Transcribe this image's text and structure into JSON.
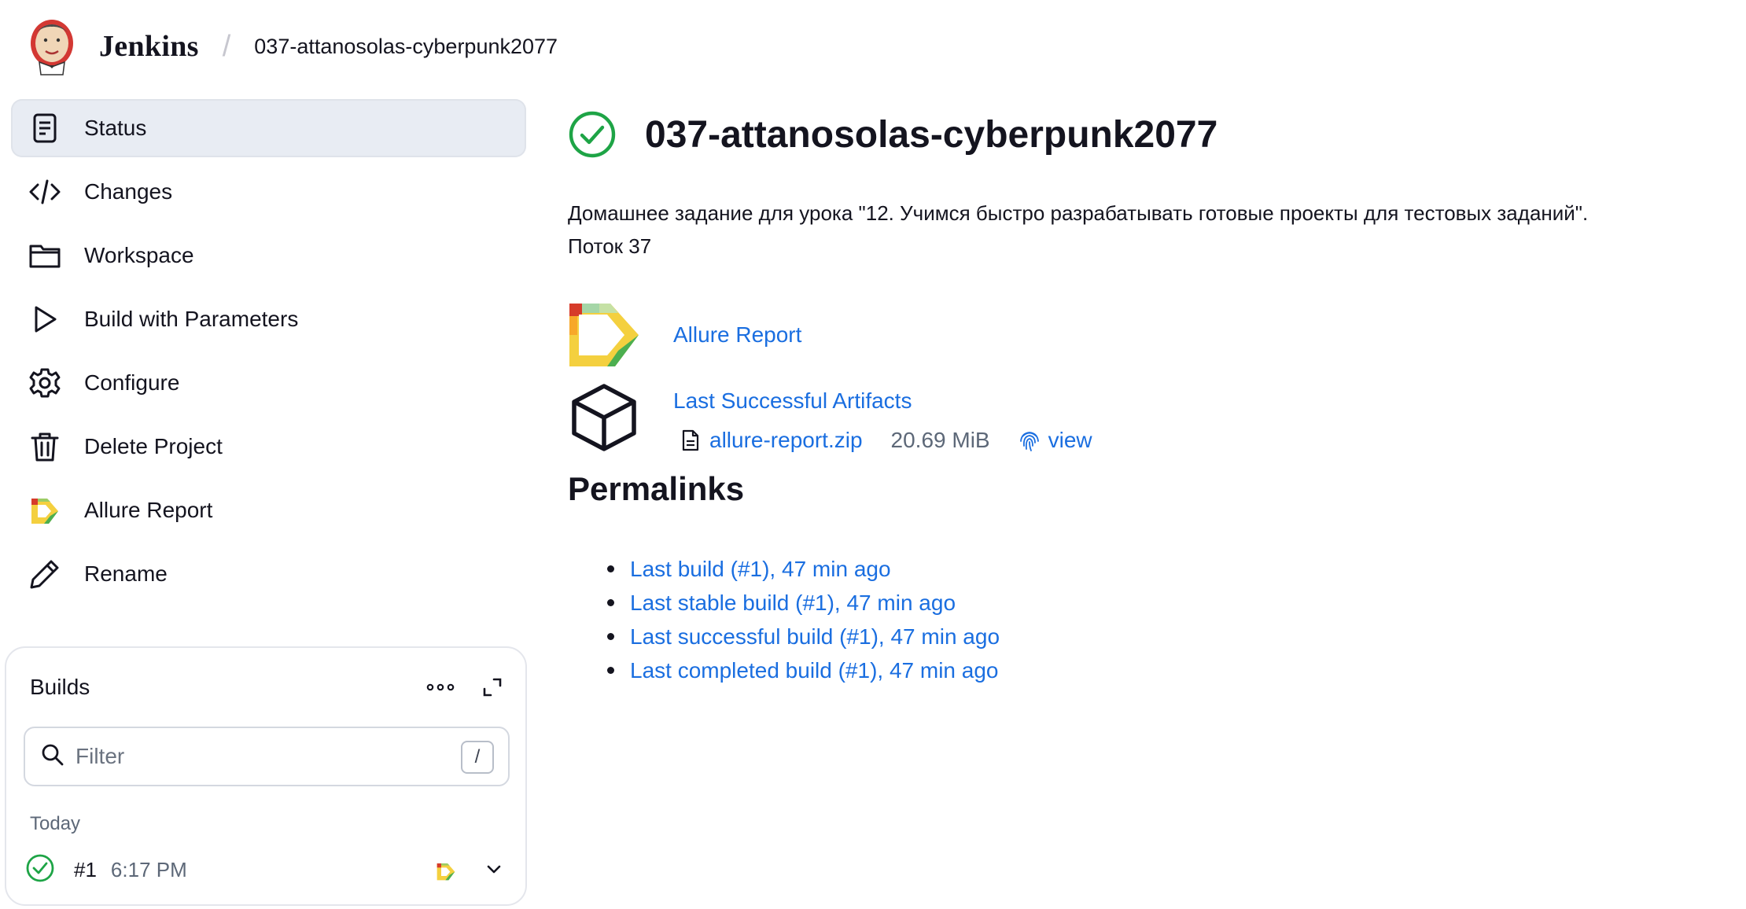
{
  "header": {
    "brand": "Jenkins",
    "separator": "/",
    "breadcrumb": "037-attanosolas-cyberpunk2077"
  },
  "sidebar": {
    "items": [
      {
        "label": "Status",
        "icon": "status-document-icon",
        "active": true
      },
      {
        "label": "Changes",
        "icon": "code-icon"
      },
      {
        "label": "Workspace",
        "icon": "folder-icon"
      },
      {
        "label": "Build with Parameters",
        "icon": "play-icon"
      },
      {
        "label": "Configure",
        "icon": "gear-icon"
      },
      {
        "label": "Delete Project",
        "icon": "trash-icon"
      },
      {
        "label": "Allure Report",
        "icon": "allure-icon"
      },
      {
        "label": "Rename",
        "icon": "pencil-icon"
      }
    ]
  },
  "builds": {
    "title": "Builds",
    "filter_placeholder": "Filter",
    "shortcut_key": "/",
    "group_label": "Today",
    "rows": [
      {
        "number": "#1",
        "time": "6:17 PM",
        "status": "success"
      }
    ]
  },
  "main": {
    "title": "037-attanosolas-cyberpunk2077",
    "description_line1": "Домашнее задание для урока \"12. Учимся быстро разрабатывать готовые проекты для тестовых заданий\".",
    "description_line2": "Поток 37",
    "allure_link": "Allure Report",
    "artifacts_link": "Last Successful Artifacts",
    "artifact_file": "allure-report.zip",
    "artifact_size": "20.69 MiB",
    "artifact_view": "view",
    "permalinks_heading": "Permalinks",
    "permalinks": [
      "Last build (#1), 47 min ago",
      "Last stable build (#1), 47 min ago",
      "Last successful build (#1), 47 min ago",
      "Last completed build (#1), 47 min ago"
    ]
  },
  "colors": {
    "link": "#1a6ee0",
    "success": "#1ea446",
    "active_nav_bg": "#e8ecf3",
    "text": "#14141f",
    "muted": "#5d6878"
  }
}
